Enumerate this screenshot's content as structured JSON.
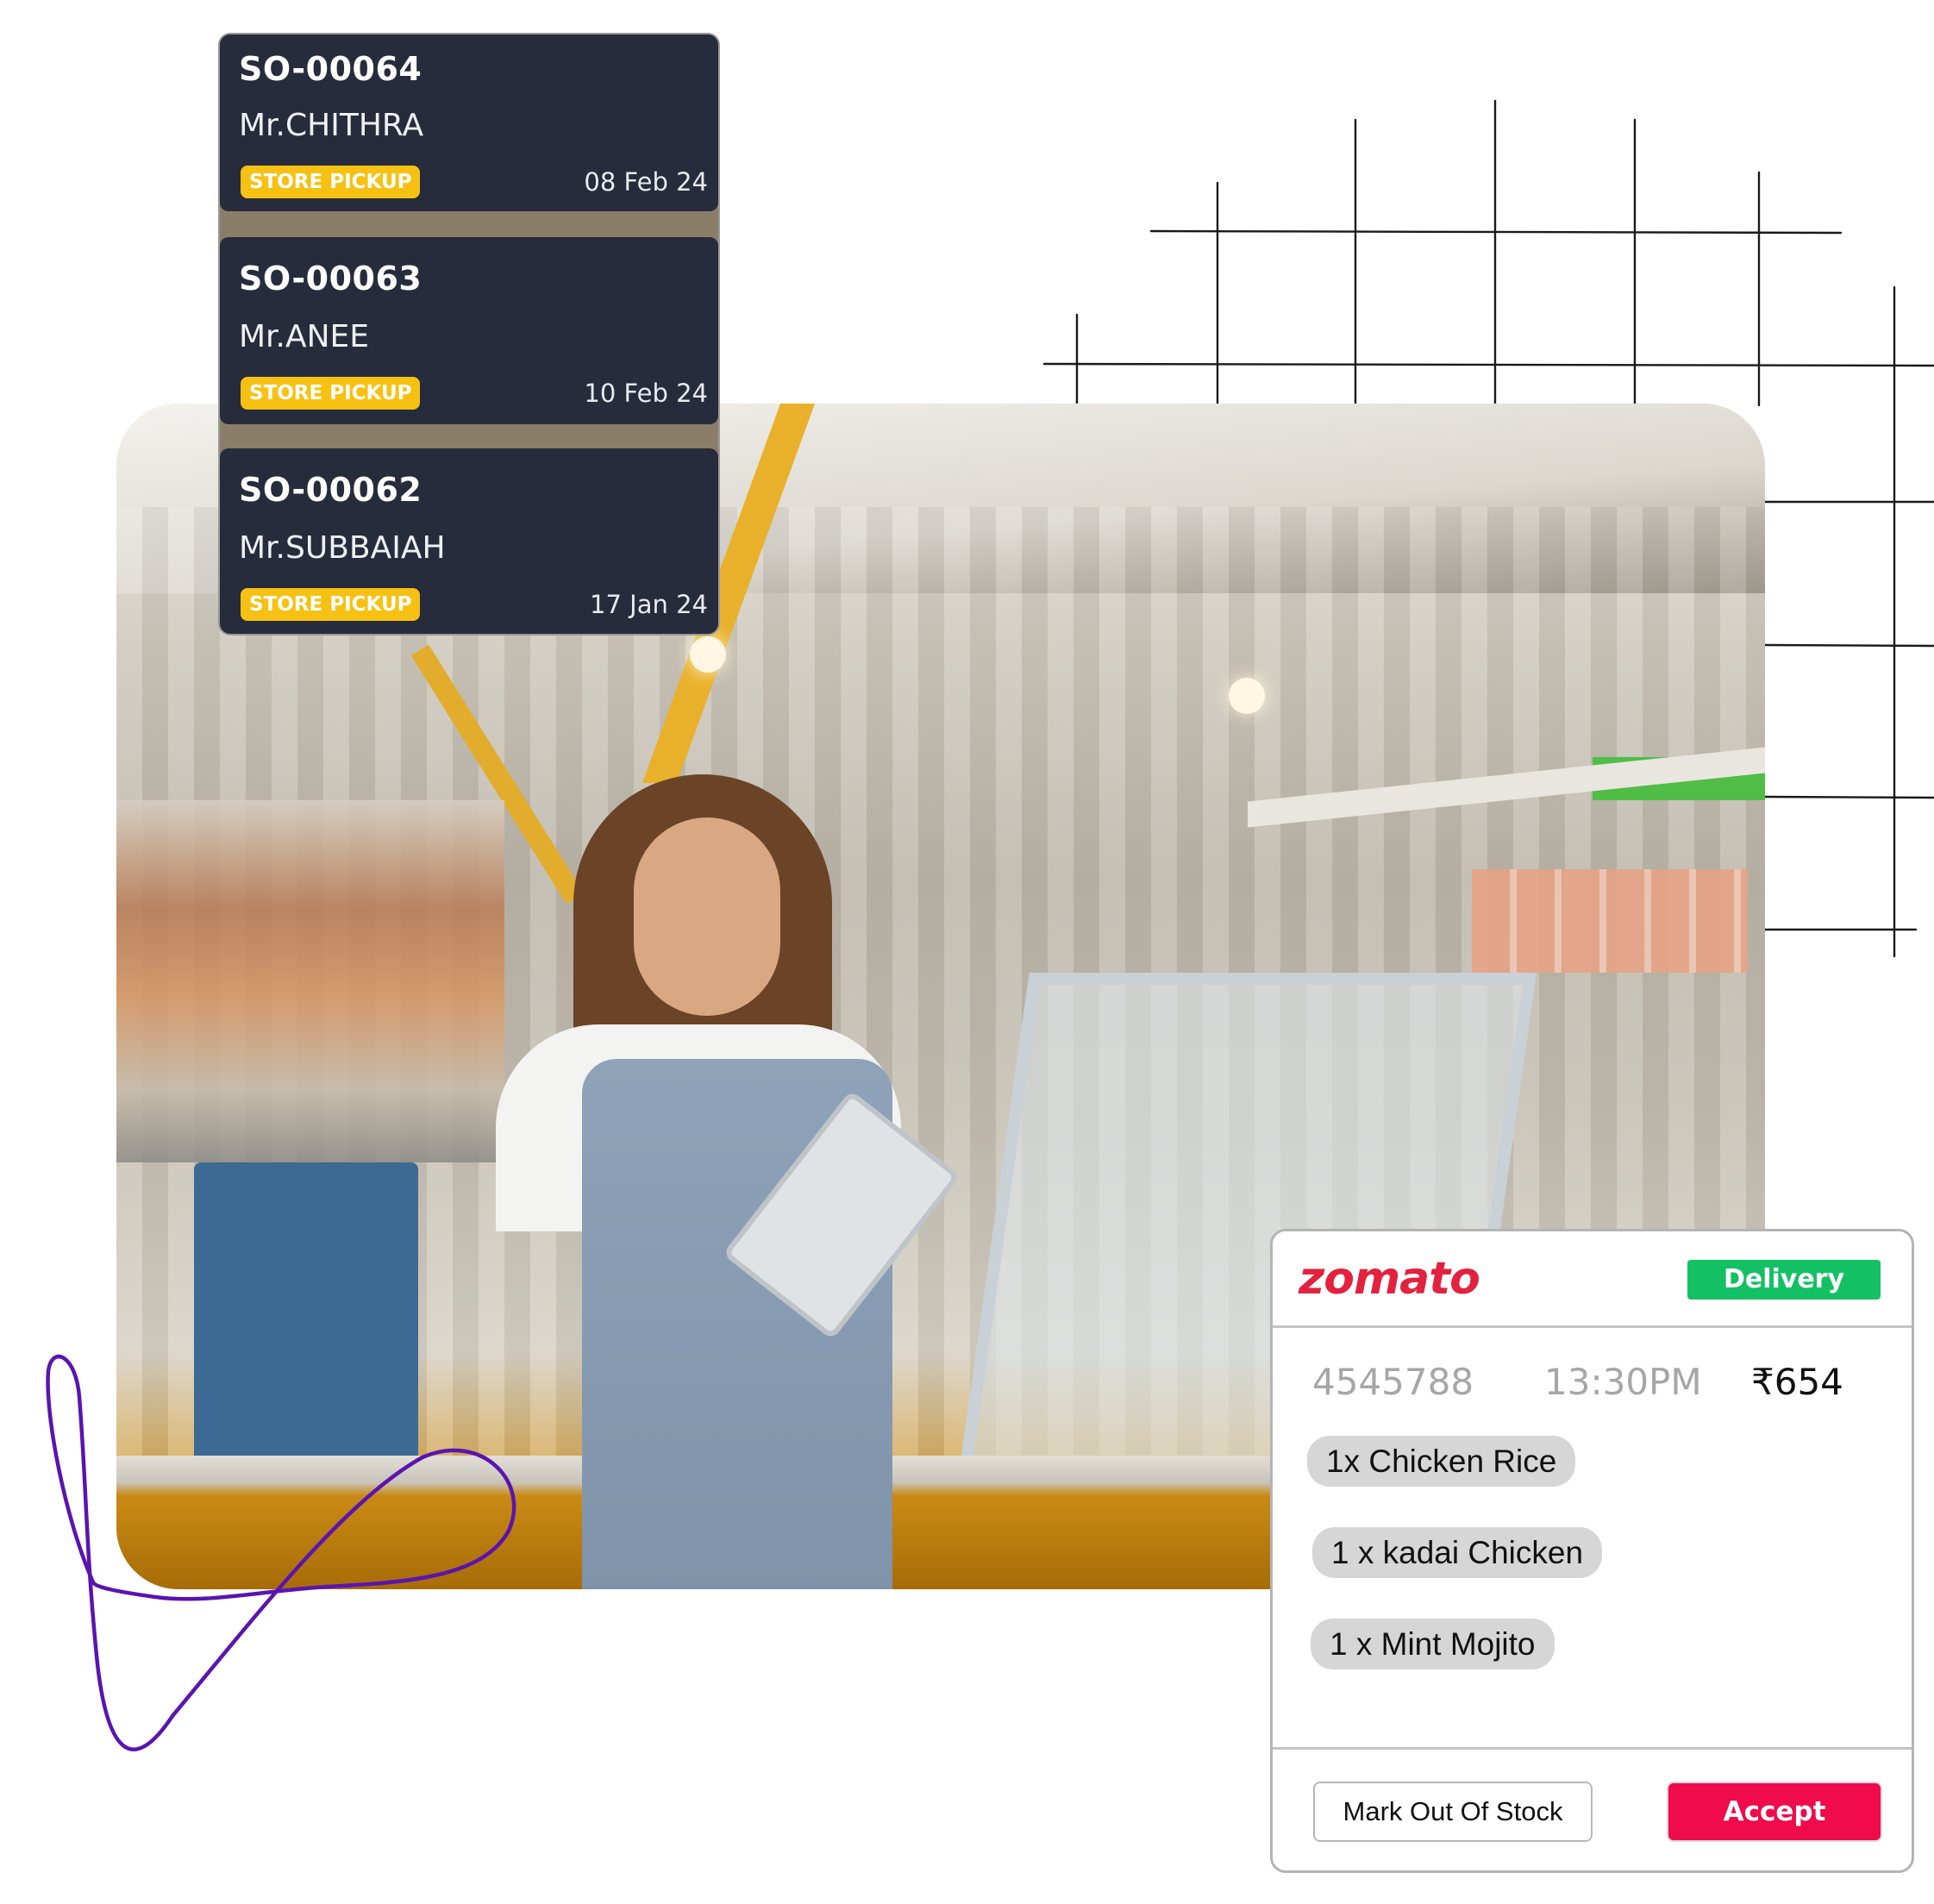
{
  "orders_panel": {
    "orders": [
      {
        "id": "SO-00064",
        "customer": "Mr.CHITHRA",
        "type": "STORE PICKUP",
        "date": "08 Feb 24"
      },
      {
        "id": "SO-00063",
        "customer": "Mr.ANEE",
        "type": "STORE PICKUP",
        "date": "10 Feb 24"
      },
      {
        "id": "SO-00062",
        "customer": "Mr.SUBBAIAH",
        "type": "STORE PICKUP",
        "date": "17 Jan 24"
      }
    ],
    "tag_color": "#f6c112",
    "card_color": "#262c3b"
  },
  "photo": {
    "description": "Smiling shop attendant in apron using a tablet inside a small food kiosk"
  },
  "zomato_card": {
    "brand": "zomato",
    "brand_color": "#e2223e",
    "order_type": "Delivery",
    "order_type_color": "#14c064",
    "order_number": "4545788",
    "time": "13:30PM",
    "amount": "₹654",
    "items": [
      "1x Chicken Rice",
      "1 x kadai Chicken",
      "1 x Mint Mojito"
    ],
    "buttons": {
      "mark_out_of_stock": "Mark Out Of Stock",
      "accept": "Accept"
    },
    "accept_color": "#ef0b4c"
  },
  "decor": {
    "swirl_color": "#5a14b0",
    "grid_color": "#1a1a1a"
  }
}
